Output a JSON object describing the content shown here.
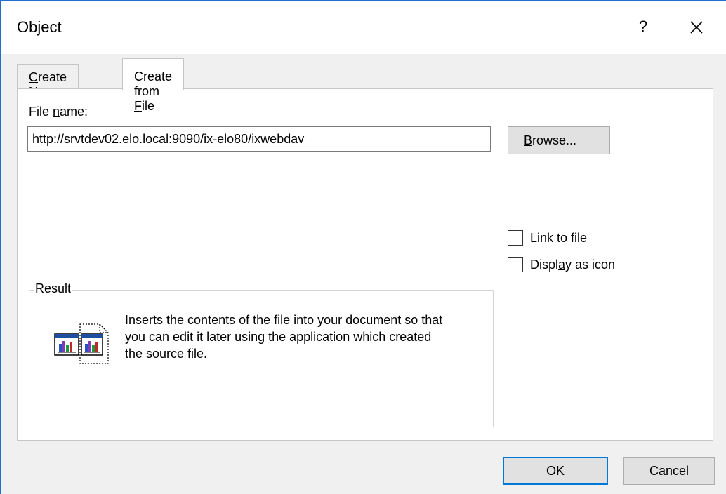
{
  "window": {
    "title": "Object",
    "help_label": "?"
  },
  "tabs": [
    {
      "pre": "",
      "key": "C",
      "post": "reate New"
    },
    {
      "pre": "Create from ",
      "key": "F",
      "post": "ile"
    }
  ],
  "file": {
    "label_pre": "File ",
    "label_key": "n",
    "label_post": "ame:",
    "value": "http://srvtdev02.elo.local:9090/ix-elo80/ixwebdav",
    "browse_key": "B",
    "browse_post": "rowse..."
  },
  "options": {
    "link": {
      "pre": "Lin",
      "key": "k",
      "post": " to file",
      "checked": false
    },
    "icon": {
      "pre": "Displ",
      "key": "a",
      "post": "y as icon",
      "checked": false
    }
  },
  "result": {
    "legend": "Result",
    "description": "Inserts the contents of the file into your document so that you can edit it later using the application which created the source file.",
    "icon": "embedded-chart-object-icon"
  },
  "buttons": {
    "ok": "OK",
    "cancel": "Cancel"
  },
  "colors": {
    "accent": "#0078d7",
    "window_border": "#1e6fd0"
  }
}
